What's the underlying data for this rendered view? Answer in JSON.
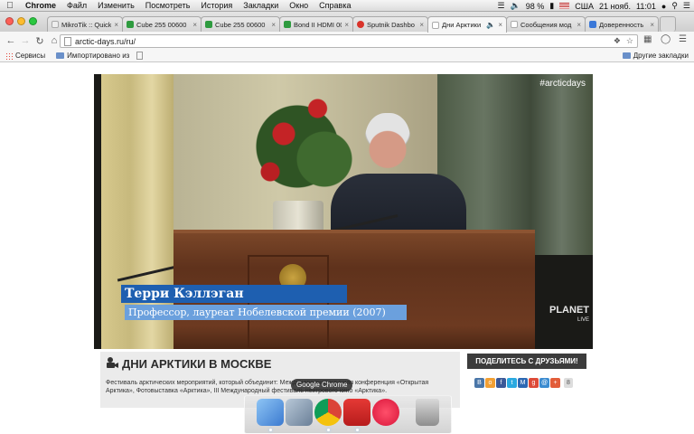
{
  "menubar": {
    "app": "Chrome",
    "items": [
      "Файл",
      "Изменить",
      "Посмотреть",
      "История",
      "Закладки",
      "Окно",
      "Справка"
    ],
    "battery": "98 %",
    "locale": "США",
    "date": "21 нояб.",
    "time": "11:01"
  },
  "tabs": [
    {
      "title": "MikroTik :: Quick",
      "color": "#eeeeee"
    },
    {
      "title": "Cube 255 00600",
      "color": "#2e9b3f"
    },
    {
      "title": "Cube 255 00600",
      "color": "#2e9b3f"
    },
    {
      "title": "Bond II HDMI 00",
      "color": "#2e9b3f"
    },
    {
      "title": "Sputnik Dashbo",
      "color": "#d9332a"
    },
    {
      "title": "Дни Арктики",
      "color": "#dddddd"
    },
    {
      "title": "Сообщения мод",
      "color": "#dddddd"
    },
    {
      "title": "Доверенность",
      "color": "#3b78d8"
    }
  ],
  "address": {
    "url": "arctic-days.ru/ru/"
  },
  "bookmarks": {
    "services": "Сервисы",
    "imported": "Импортировано из",
    "other": "Другие закладки"
  },
  "video": {
    "hashtag": "#arcticdays",
    "speaker_name": "Терри Кэллэган",
    "speaker_title": "Профессор, лауреат Нобелевской премии (2007)",
    "channel": "PLANET",
    "channel_sub": "LIVE"
  },
  "event": {
    "title": "ДНИ АРКТИКИ В МОСКВЕ",
    "description": "Фестиваль арктических мероприятий, который объединит: Международная научная конференция «Открытая Арктика», Фотовыставка «Арктика», III Международный фестиваль неигрового кино «Арктика»."
  },
  "share": {
    "label": "ПОДЕЛИТЕСЬ С ДРУЗЬЯМИ!",
    "buttons": [
      {
        "glyph": "В",
        "color": "#4a76a8"
      },
      {
        "glyph": "o",
        "color": "#f2a034"
      },
      {
        "glyph": "f",
        "color": "#3b5998"
      },
      {
        "glyph": "t",
        "color": "#2aa9e0"
      },
      {
        "glyph": "M",
        "color": "#2d68b3"
      },
      {
        "glyph": "g",
        "color": "#dd4b39"
      },
      {
        "glyph": "@",
        "color": "#3b8bd0"
      },
      {
        "glyph": "+",
        "color": "#e25d3a"
      }
    ],
    "count": "8"
  },
  "dock": {
    "tooltip": "Google Chrome"
  }
}
